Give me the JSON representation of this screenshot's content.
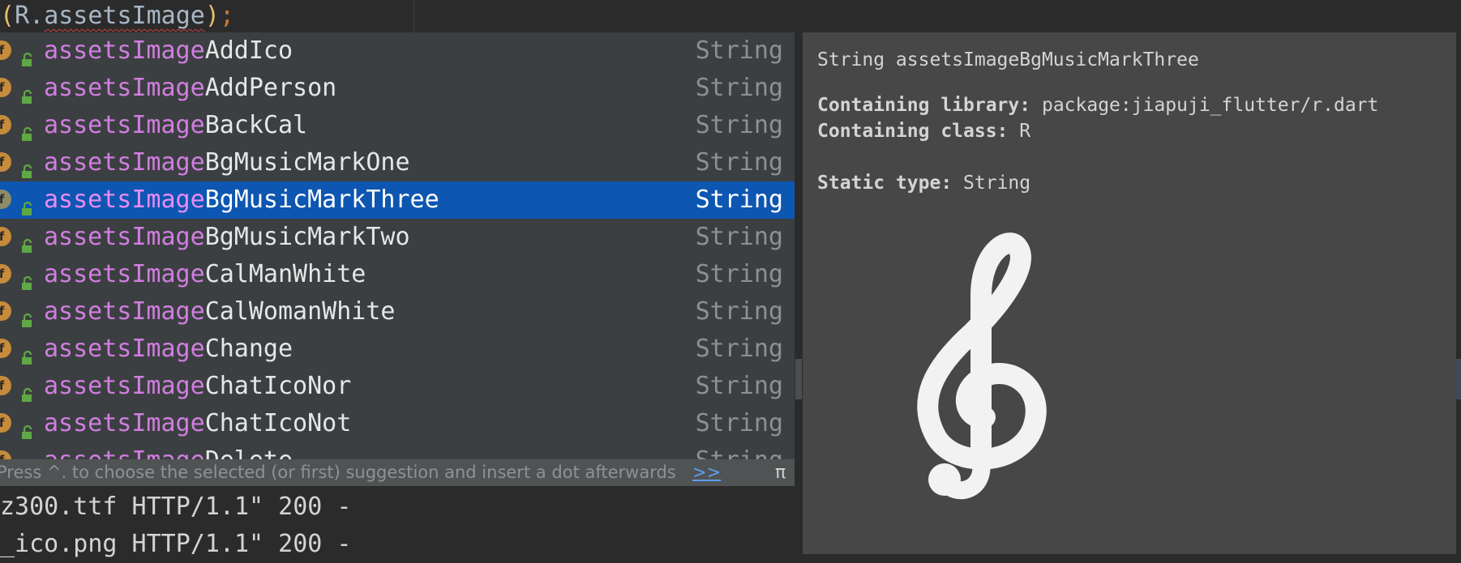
{
  "editor": {
    "paren_open": "(",
    "class_name": "R",
    "dot": ".",
    "identifier": "assetsImage",
    "paren_close": ")",
    "semicolon": ";"
  },
  "completion": {
    "items": [
      {
        "match": "assetsImage",
        "rest": "AddIco",
        "type": "String"
      },
      {
        "match": "assetsImage",
        "rest": "AddPerson",
        "type": "String"
      },
      {
        "match": "assetsImage",
        "rest": "BackCal",
        "type": "String"
      },
      {
        "match": "assetsImage",
        "rest": "BgMusicMarkOne",
        "type": "String"
      },
      {
        "match": "assetsImage",
        "rest": "BgMusicMarkThree",
        "type": "String",
        "selected": true
      },
      {
        "match": "assetsImage",
        "rest": "BgMusicMarkTwo",
        "type": "String"
      },
      {
        "match": "assetsImage",
        "rest": "CalManWhite",
        "type": "String"
      },
      {
        "match": "assetsImage",
        "rest": "CalWomanWhite",
        "type": "String"
      },
      {
        "match": "assetsImage",
        "rest": "Change",
        "type": "String"
      },
      {
        "match": "assetsImage",
        "rest": "ChatIcoNor",
        "type": "String"
      },
      {
        "match": "assetsImage",
        "rest": "ChatIcoNot",
        "type": "String"
      },
      {
        "match": "assetsImage",
        "rest": "Delete",
        "type": "String"
      }
    ],
    "badge_letter": "f",
    "hint": "Press ^. to choose the selected (or first) suggestion and insert a dot afterwards",
    "hint_link": ">>",
    "pi": "π"
  },
  "console": {
    "lines": [
      "z300.ttf HTTP/1.1\" 200 -",
      "_ico.png HTTP/1.1\" 200 -"
    ]
  },
  "doc": {
    "signature": "String assetsImageBgMusicMarkThree",
    "library_label": "Containing library:",
    "library_value": "package:jiapuji_flutter/r.dart",
    "class_label": "Containing class:",
    "class_value": "R",
    "static_type_label": "Static type:",
    "static_type_value": "String",
    "preview_icon": "treble-clef-icon"
  },
  "colors": {
    "selection": "#0d56b1",
    "match_highlight": "#d07ee0",
    "popup_bg": "#3c3f41",
    "doc_bg": "#474747"
  }
}
